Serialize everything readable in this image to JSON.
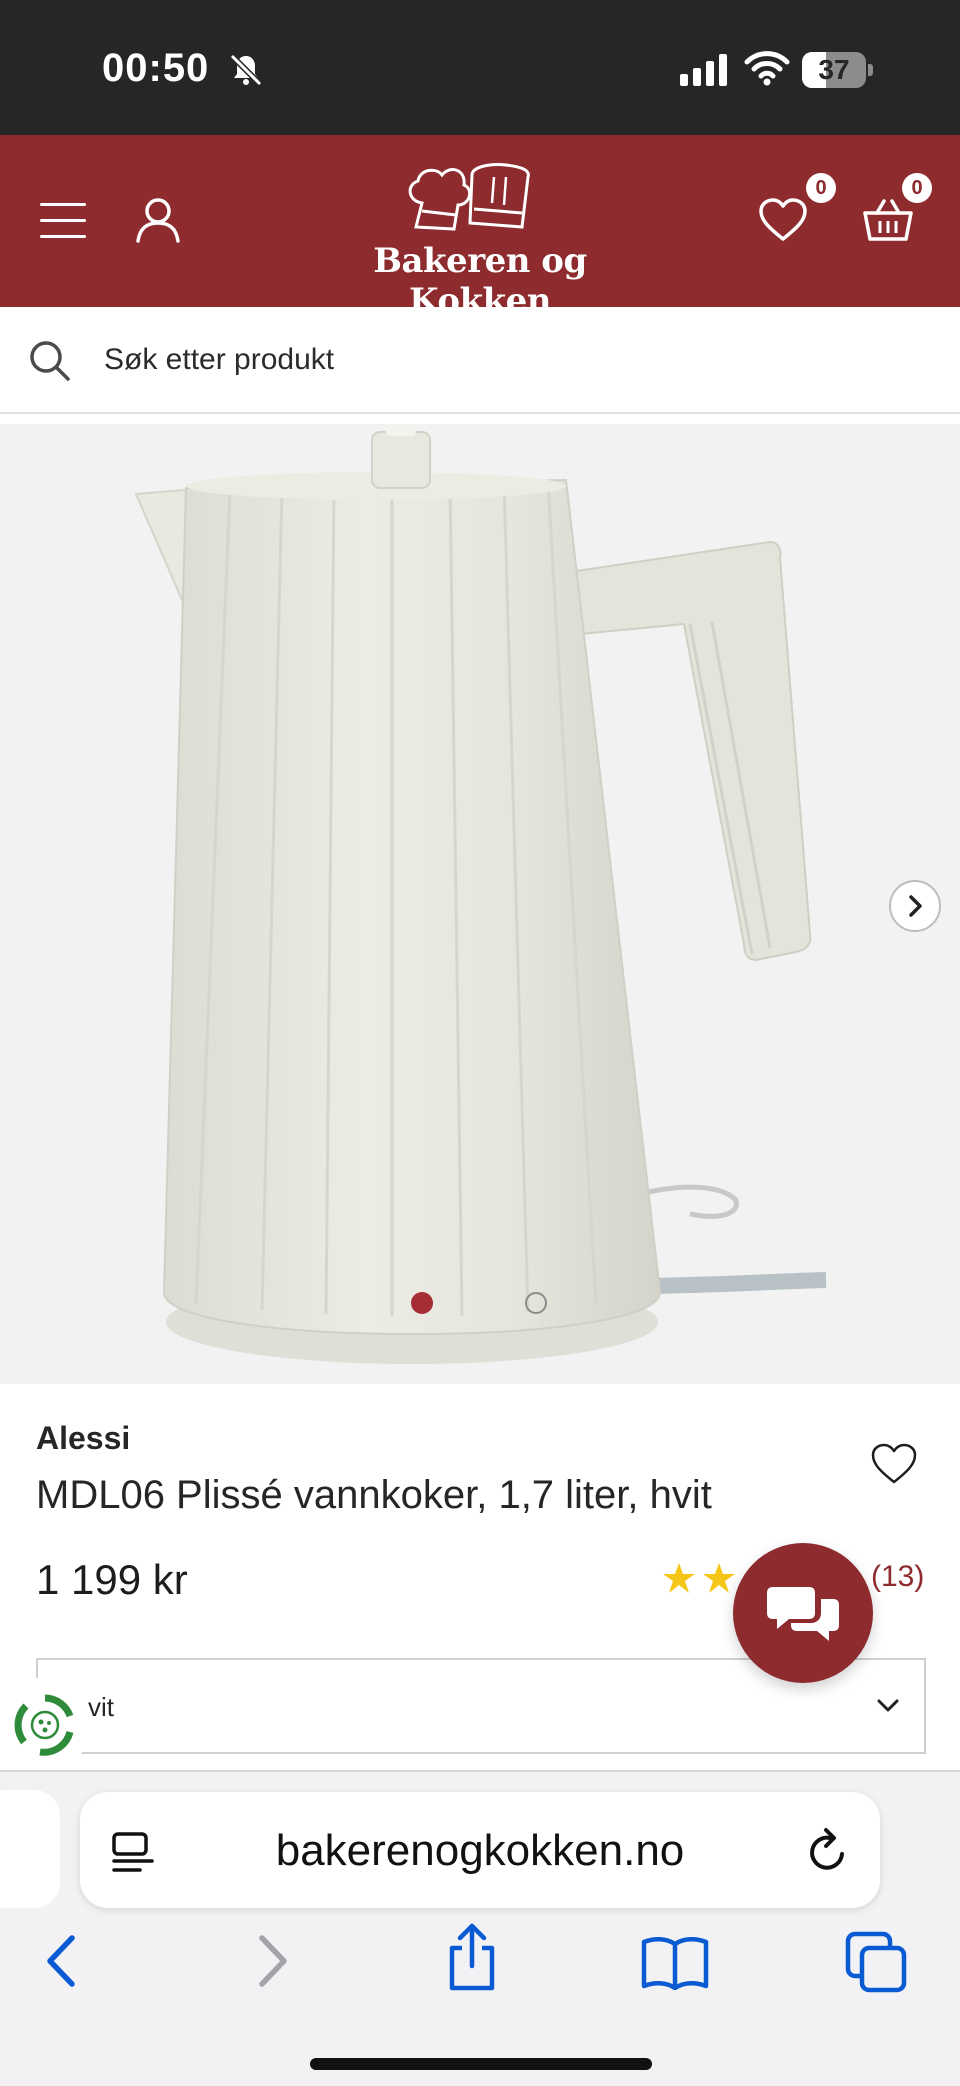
{
  "status_bar": {
    "time": "00:50",
    "battery_level": "37",
    "battery_fraction": 0.37
  },
  "header": {
    "logo_text": "Bakeren og Kokken",
    "wishlist_count": "0",
    "cart_count": "0",
    "brand_color": "#8d2b2e"
  },
  "search": {
    "placeholder": "Søk etter produkt"
  },
  "gallery": {
    "image_alt": "Hvit plissert vannkoker",
    "slide_count": 2,
    "active_slide": 1
  },
  "product": {
    "brand": "Alessi",
    "title": "MDL06 Plissé vannkoker, 1,7 liter, hvit",
    "price": "1 199 kr",
    "review_count": "(13)",
    "variant_value": "vit",
    "visible_stars": 2
  },
  "browser": {
    "address": "bakerenogkokken.no",
    "accent_color": "#0a5bd3"
  },
  "icons": {
    "menu": "hamburger-icon",
    "account": "user-icon",
    "wishlist": "heart-icon",
    "cart": "basket-icon",
    "search": "search-icon",
    "chat": "chat-icon",
    "next": "chevron-right-icon"
  }
}
